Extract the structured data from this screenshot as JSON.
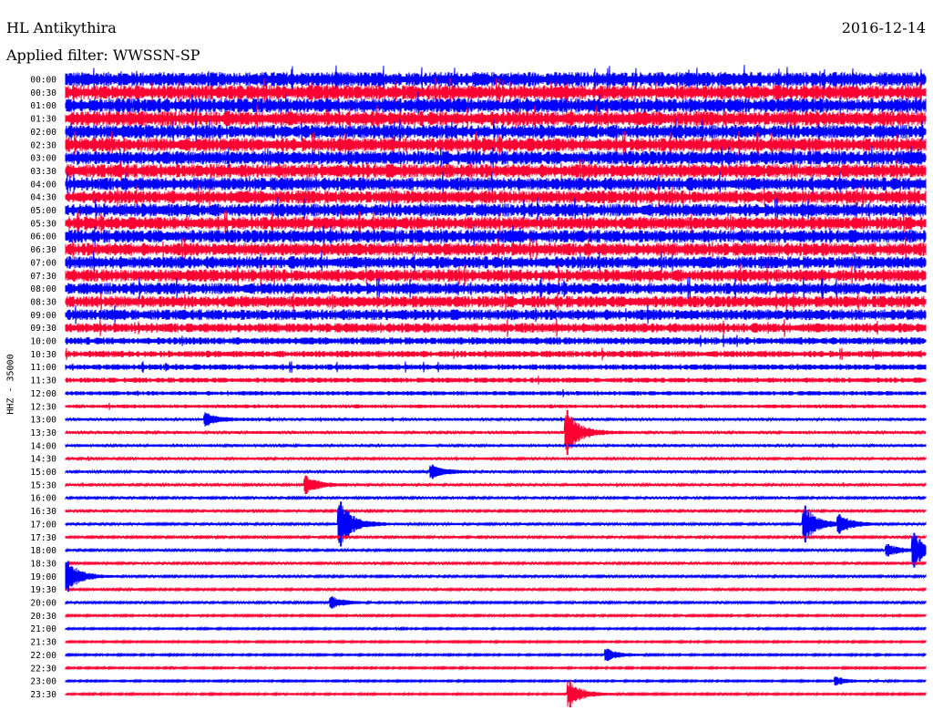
{
  "header": {
    "station": "HL Antikythira",
    "date": "2016-12-14",
    "filter": "Applied filter: WWSSN-SP"
  },
  "colors": {
    "blue": "#0000ff",
    "red": "#ff0033"
  },
  "chart_data": {
    "type": "line",
    "title": "HL Antikythira",
    "ylabel": "HHZ - 35000",
    "time_labels": [
      "00:00",
      "00:30",
      "01:00",
      "01:30",
      "02:00",
      "02:30",
      "03:00",
      "03:30",
      "04:00",
      "04:30",
      "05:00",
      "05:30",
      "06:00",
      "06:30",
      "07:00",
      "07:30",
      "08:00",
      "08:30",
      "09:00",
      "09:30",
      "10:00",
      "10:30",
      "11:00",
      "11:30",
      "12:00",
      "12:30",
      "13:00",
      "13:30",
      "14:00",
      "14:30",
      "15:00",
      "15:30",
      "16:00",
      "16:30",
      "17:00",
      "17:30",
      "18:00",
      "18:30",
      "19:00",
      "19:30",
      "20:00",
      "20:30",
      "21:00",
      "21:30",
      "22:00",
      "22:30",
      "23:00",
      "23:30"
    ],
    "trace_colors": [
      "blue",
      "red"
    ],
    "noise_level": [
      1.0,
      1.0,
      1.0,
      1.0,
      0.95,
      0.95,
      0.95,
      0.95,
      0.9,
      0.9,
      0.9,
      0.9,
      0.9,
      0.9,
      0.85,
      0.85,
      0.8,
      0.8,
      0.75,
      0.65,
      0.5,
      0.45,
      0.4,
      0.35,
      0.3,
      0.25,
      0.2,
      0.2,
      0.2,
      0.18,
      0.18,
      0.18,
      0.16,
      0.16,
      0.16,
      0.15,
      0.15,
      0.15,
      0.15,
      0.14,
      0.14,
      0.13,
      0.12,
      0.12,
      0.12,
      0.12,
      0.12,
      0.12
    ],
    "events": [
      {
        "line": "13:00",
        "minute": 4.9,
        "amplitude": 0.6
      },
      {
        "line": "13:30",
        "minute": 17.5,
        "amplitude": 2.2
      },
      {
        "line": "15:00",
        "minute": 12.8,
        "amplitude": 0.7
      },
      {
        "line": "15:30",
        "minute": 8.4,
        "amplitude": 0.9
      },
      {
        "line": "17:00",
        "minute": 9.6,
        "amplitude": 2.2
      },
      {
        "line": "17:00",
        "minute": 25.8,
        "amplitude": 1.8
      },
      {
        "line": "17:00",
        "minute": 27.0,
        "amplitude": 0.9
      },
      {
        "line": "18:00",
        "minute": 28.7,
        "amplitude": 0.6
      },
      {
        "line": "18:00",
        "minute": 29.6,
        "amplitude": 1.7
      },
      {
        "line": "19:00",
        "minute": 0.1,
        "amplitude": 1.5
      },
      {
        "line": "20:00",
        "minute": 9.3,
        "amplitude": 0.6
      },
      {
        "line": "22:00",
        "minute": 18.9,
        "amplitude": 0.6
      },
      {
        "line": "23:00",
        "minute": 26.9,
        "amplitude": 0.4
      },
      {
        "line": "23:30",
        "minute": 17.6,
        "amplitude": 1.3
      }
    ],
    "grid": false
  }
}
